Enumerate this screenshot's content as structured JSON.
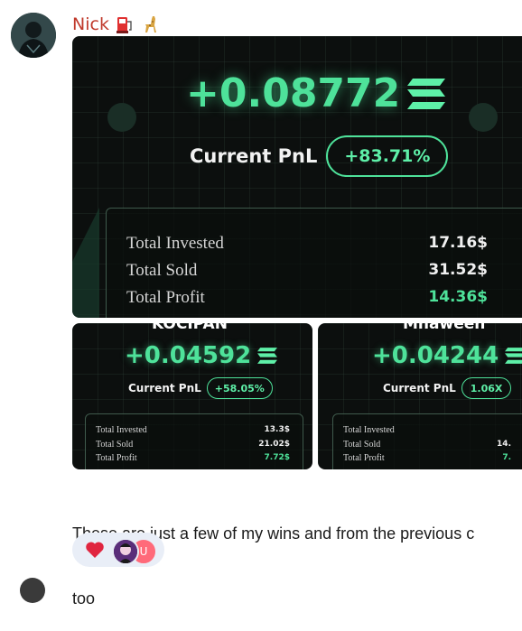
{
  "message": {
    "sender": "Nick",
    "sender_emojis": [
      "fuel-pump-emoji",
      "giraffe-emoji"
    ],
    "caption_line1": "These are just a few of my wins and from the previous c",
    "caption_line2": "too"
  },
  "cards": {
    "main": {
      "amount": "+0.08772",
      "pnl_label": "Current PnL",
      "pnl_value": "+83.71%",
      "stats": [
        {
          "label": "Total Invested",
          "value": "17.16$"
        },
        {
          "label": "Total Sold",
          "value": "31.52$"
        },
        {
          "label": "Total Profit",
          "value": "14.36$"
        }
      ]
    },
    "left": {
      "title": "KOCIPAN",
      "amount": "+0.04592",
      "pnl_label": "Current PnL",
      "pnl_value": "+58.05%",
      "stats": [
        {
          "label": "Total Invested",
          "value": "13.3$"
        },
        {
          "label": "Total Sold",
          "value": "21.02$"
        },
        {
          "label": "Total Profit",
          "value": "7.72$"
        }
      ]
    },
    "right": {
      "title": "Mhaween",
      "amount": "+0.04244",
      "pnl_label": "Current PnL",
      "pnl_value": "1.06X",
      "stats": [
        {
          "label": "Total Invested",
          "value": ""
        },
        {
          "label": "Total Sold",
          "value": "14."
        },
        {
          "label": "Total Profit",
          "value": "7."
        }
      ]
    }
  },
  "reactions": [
    {
      "icon": "heart-icon"
    },
    {
      "icon": "reactor-avatar"
    },
    {
      "icon": "reactor-avatar-initial",
      "initial": "U"
    }
  ],
  "colors": {
    "sender": "#c0392b",
    "accent_green": "#4ee29a",
    "card_bg": "#0c0f0e",
    "reaction_bg": "#e9eef7"
  }
}
